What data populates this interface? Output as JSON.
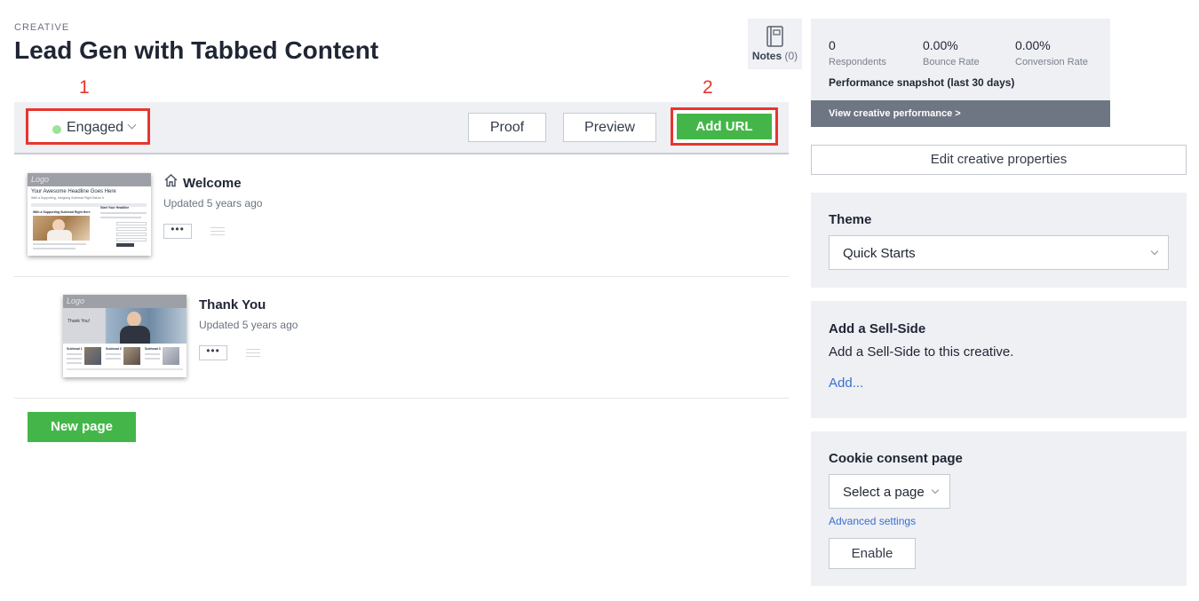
{
  "header": {
    "eyebrow": "CREATIVE",
    "title": "Lead Gen with Tabbed Content",
    "notes_label": "Notes",
    "notes_count": "(0)"
  },
  "annotations": {
    "first": "1",
    "second": "2"
  },
  "toolbar": {
    "status_label": "Engaged",
    "status_color": "#9be39a",
    "proof_label": "Proof",
    "preview_label": "Preview",
    "add_url_label": "Add URL"
  },
  "pages": [
    {
      "name": "Welcome",
      "updated": "Updated 5 years ago",
      "is_home": true,
      "thumb_logo": "Logo",
      "thumb_headline": "Your Awesome Headline Goes Here",
      "thumb_subheadline": "With a Supporting, Intriguing Subhead Right Below It",
      "thumb_section": "With a Supporting Subhead Right Here",
      "thumb_form_title": "Start Your Headline"
    },
    {
      "name": "Thank You",
      "updated": "Updated 5 years ago",
      "is_home": false,
      "thumb_logo": "Logo",
      "thumb_headline": "Thank You!",
      "thumb_col_1": "Subhead 1",
      "thumb_col_2": "Subhead 2",
      "thumb_col_3": "Subhead 3"
    }
  ],
  "more_label": "•••",
  "new_page_label": "New page",
  "performance": {
    "metrics": [
      {
        "value": "0",
        "label": "Respondents"
      },
      {
        "value": "0.00%",
        "label": "Bounce Rate"
      },
      {
        "value": "0.00%",
        "label": "Conversion Rate"
      }
    ],
    "caption": "Performance snapshot (last 30 days)",
    "link_label": "View creative performance >"
  },
  "edit_properties_label": "Edit creative properties",
  "theme": {
    "title": "Theme",
    "selected": "Quick Starts"
  },
  "sell_side": {
    "title": "Add a Sell-Side",
    "description": "Add a Sell-Side to this creative.",
    "add_link": "Add..."
  },
  "cookie": {
    "title": "Cookie consent page",
    "select_placeholder": "Select a page",
    "advanced_link": "Advanced settings",
    "enable_label": "Enable"
  },
  "colors": {
    "primary_green": "#44b649",
    "annotation_red": "#e8352e",
    "link_blue": "#3a6fcf",
    "panel_bg": "#eef0f4"
  }
}
